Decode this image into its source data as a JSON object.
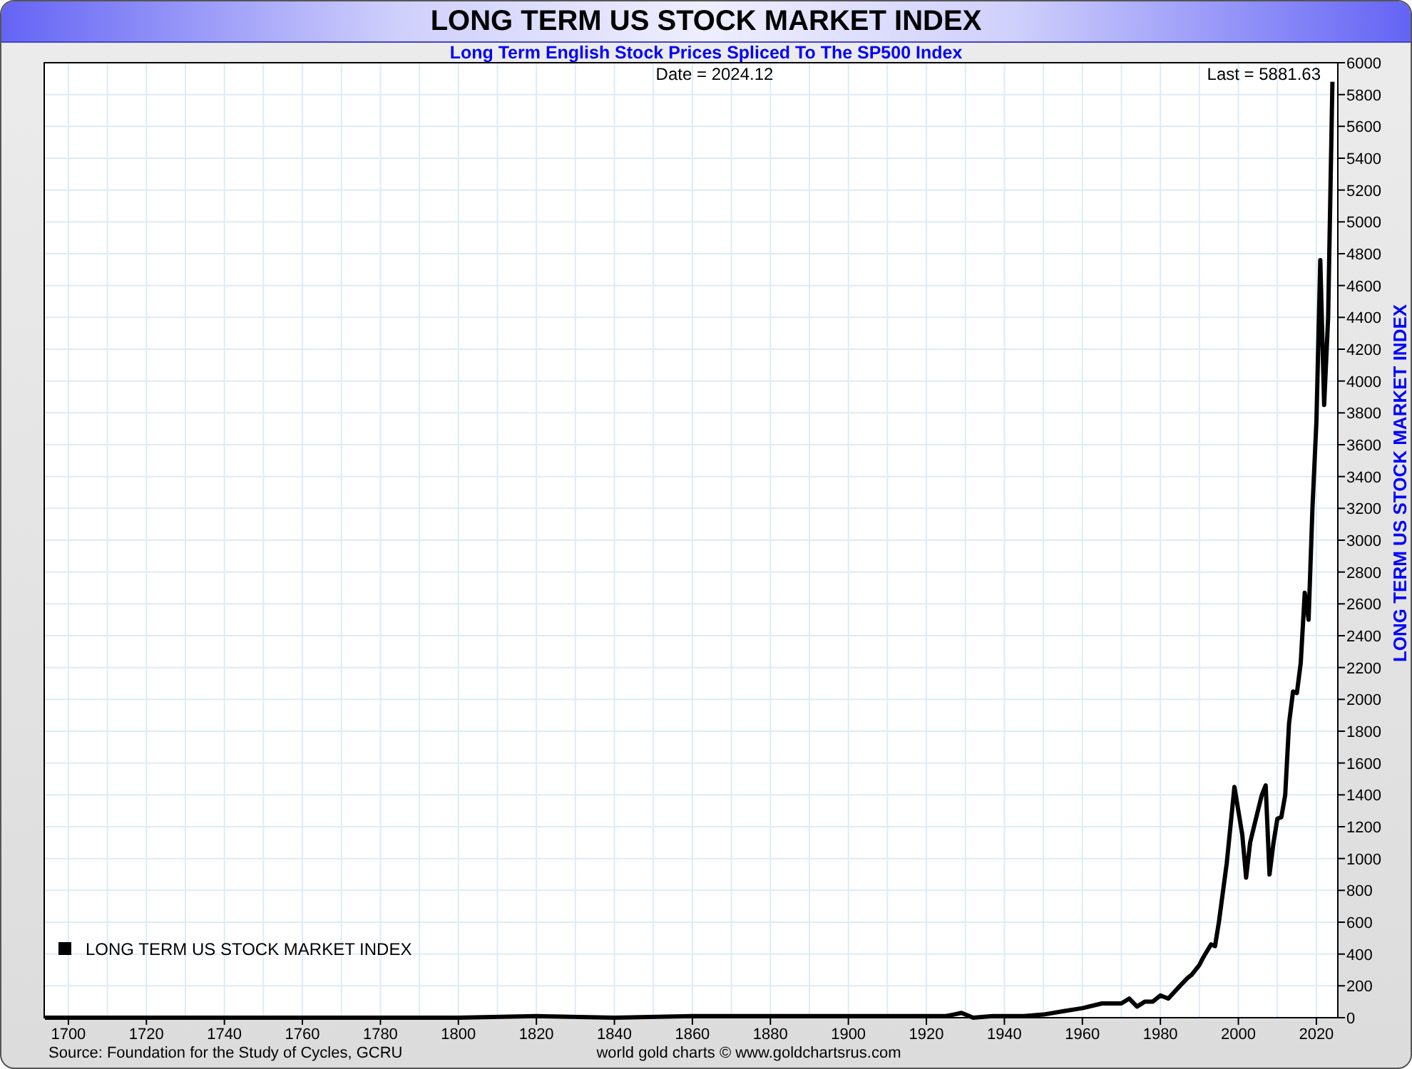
{
  "title": "LONG TERM US STOCK MARKET INDEX",
  "subtitle": "Long Term English Stock Prices Spliced To The SP500 Index",
  "date_label": "Date = 2024.12",
  "last_label": "Last = 5881.63",
  "source": "Source: Foundation for the Study of Cycles, GCRU",
  "credit": "world gold charts © www.goldchartsrus.com",
  "chart_data": {
    "type": "line",
    "ylabel": "LONG TERM US STOCK MARKET INDEX",
    "x": [
      1694,
      1700,
      1720,
      1740,
      1760,
      1780,
      1800,
      1820,
      1840,
      1860,
      1880,
      1900,
      1910,
      1920,
      1925,
      1927,
      1929,
      1932,
      1937,
      1940,
      1945,
      1950,
      1955,
      1960,
      1965,
      1970,
      1972,
      1974,
      1976,
      1978,
      1980,
      1982,
      1985,
      1987,
      1988,
      1990,
      1991,
      1993,
      1994,
      1995,
      1997,
      1999,
      2001,
      2002,
      2003,
      2004,
      2006,
      2007,
      2008,
      2009,
      2010,
      2011,
      2012,
      2013,
      2014,
      2015,
      2016,
      2017,
      2018,
      2019,
      2020,
      2021,
      2022,
      2023,
      2024.12
    ],
    "series": [
      {
        "name": "LONG TERM US STOCK MARKET INDEX",
        "color": "#000000",
        "values": [
          0,
          0,
          0,
          0,
          0,
          0,
          0,
          10,
          0,
          10,
          10,
          10,
          10,
          10,
          10,
          20,
          30,
          0,
          10,
          10,
          10,
          20,
          40,
          60,
          90,
          90,
          120,
          70,
          100,
          100,
          140,
          120,
          200,
          250,
          270,
          330,
          380,
          460,
          450,
          600,
          970,
          1450,
          1150,
          880,
          1100,
          1200,
          1400,
          1460,
          900,
          1100,
          1250,
          1260,
          1400,
          1850,
          2050,
          2040,
          2230,
          2670,
          2500,
          3200,
          3750,
          4760,
          3850,
          4400,
          5880
        ]
      }
    ],
    "grid": true,
    "xlim": [
      1693.8,
      2025.5
    ],
    "ylim": [
      0,
      6000
    ],
    "xticks": [
      1700,
      1720,
      1740,
      1760,
      1780,
      1800,
      1820,
      1840,
      1860,
      1880,
      1900,
      1920,
      1940,
      1960,
      1980,
      2000,
      2020
    ],
    "yticks": [
      0,
      200,
      400,
      600,
      800,
      1000,
      1200,
      1400,
      1600,
      1800,
      2000,
      2200,
      2400,
      2600,
      2800,
      3000,
      3200,
      3400,
      3600,
      3800,
      4000,
      4200,
      4400,
      4600,
      4800,
      5000,
      5200,
      5400,
      5600,
      5800,
      6000
    ]
  }
}
